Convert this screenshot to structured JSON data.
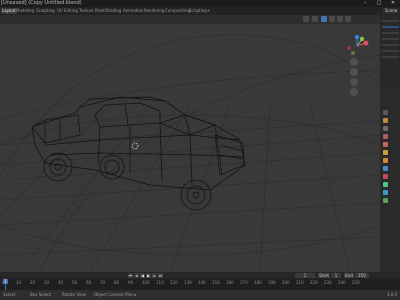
{
  "window": {
    "title": "[Unsaved] (Copy Untitled.blend)",
    "minimize_glyph": "–",
    "maximize_glyph": "□",
    "close_glyph": "✕"
  },
  "tabs": [
    {
      "label": "Layout",
      "active": true
    },
    {
      "label": "Modeling",
      "active": false
    },
    {
      "label": "Sculpting",
      "active": false
    },
    {
      "label": "UV Editing",
      "active": false
    },
    {
      "label": "Texture Paint",
      "active": false
    },
    {
      "label": "Shading",
      "active": false
    },
    {
      "label": "Animation",
      "active": false
    },
    {
      "label": "Rendering",
      "active": false
    },
    {
      "label": "Compositing",
      "active": false
    },
    {
      "label": "Scripting",
      "active": false
    },
    {
      "label": "+",
      "active": false
    }
  ],
  "scene": {
    "name": "Scene"
  },
  "viewport": {
    "shading_mode": "wireframe",
    "accent": "#4772b3"
  },
  "gizmo_colors": {
    "x": "#e05060",
    "y": "#8bc34a",
    "z": "#3b82f6"
  },
  "timeline": {
    "current_frame": "1",
    "start_label": "Start",
    "start": "1",
    "end_label": "End",
    "end": "250",
    "ticks": [
      "0",
      "10",
      "20",
      "30",
      "40",
      "50",
      "60",
      "70",
      "80",
      "90",
      "100",
      "110",
      "120",
      "130",
      "140",
      "150",
      "160",
      "170",
      "180",
      "190",
      "200",
      "210",
      "220",
      "230",
      "240",
      "250"
    ],
    "controls": [
      "jump-start-icon",
      "prev-key-icon",
      "play-reverse-icon",
      "play-icon",
      "next-key-icon",
      "jump-end-icon"
    ]
  },
  "statusbar": {
    "select": "Select",
    "box_select": "Box Select",
    "rotate_view": "Rotate View",
    "context_menu": "Object Context Menu",
    "version": "3.0.0"
  }
}
